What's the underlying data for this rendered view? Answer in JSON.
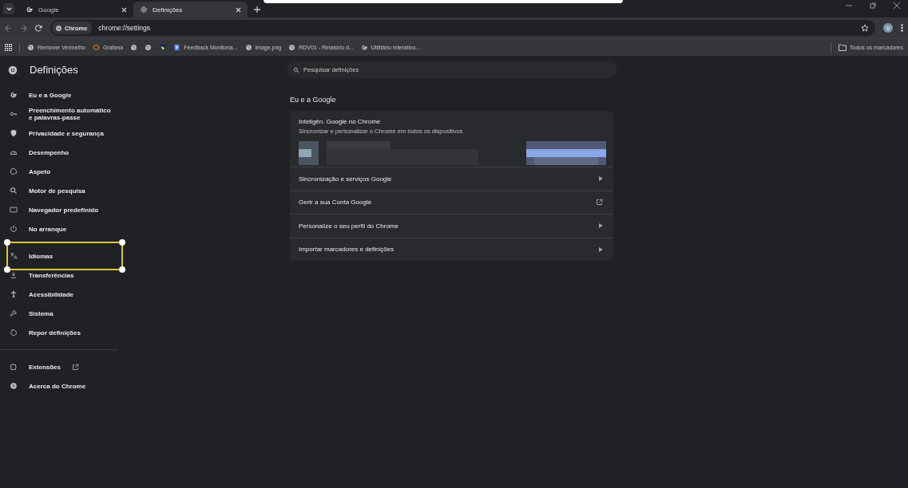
{
  "tabs": [
    {
      "title": "Google",
      "kind": "google",
      "selected": false
    },
    {
      "title": "Definições",
      "kind": "gear",
      "selected": true
    }
  ],
  "toolbar": {
    "chip": "Chrome",
    "url": "chrome://settings",
    "profile": "V"
  },
  "bookmarks": [
    {
      "kind": "globe",
      "title": "Remover Vermelho"
    },
    {
      "kind": "grafana",
      "title": "Grafana"
    },
    {
      "kind": "globe"
    },
    {
      "kind": "globe"
    },
    {
      "kind": "hand"
    },
    {
      "kind": "doc",
      "title": "Feedback Monitoria..."
    },
    {
      "kind": "globe",
      "title": "image.png"
    },
    {
      "kind": "globe",
      "title": "RDV01 - Relatório d..."
    },
    {
      "kind": "google",
      "title": "Utilitário interativo..."
    }
  ],
  "all_bookmarks": "Todos os marcadores",
  "sidebar": {
    "title": "Definições",
    "items": [
      {
        "kind": "google",
        "label": "Eu e a Google",
        "annotated": false
      },
      {
        "kind": "key",
        "label": "Preenchimento automático e palavras-passe",
        "annotated": false
      },
      {
        "kind": "shield",
        "label": "Privacidade e segurança",
        "annotated": false
      },
      {
        "kind": "gauge",
        "label": "Desempenho",
        "annotated": false
      },
      {
        "kind": "palette",
        "label": "Aspeto",
        "annotated": false
      },
      {
        "kind": "search",
        "label": "Motor de pesquisa",
        "annotated": false
      },
      {
        "kind": "window",
        "label": "Navegador predefinido",
        "annotated": false
      },
      {
        "kind": "power",
        "label": "No arranque",
        "annotated": false
      },
      {
        "kind": "translate",
        "label": "Idiomas",
        "annotated": true
      },
      {
        "kind": "download",
        "label": "Transferências",
        "annotated": false
      },
      {
        "kind": "person",
        "label": "Acessibilidade",
        "annotated": false
      },
      {
        "kind": "wrench",
        "label": "Sistema",
        "annotated": false
      },
      {
        "kind": "reset",
        "label": "Repor definições",
        "annotated": false
      }
    ],
    "extra": [
      {
        "kind": "puzzle",
        "label": "Extensões",
        "external": true
      },
      {
        "kind": "chrome",
        "label": "Acerca do Chrome",
        "external": false
      }
    ]
  },
  "search": {
    "placeholder": "Pesquisar definições"
  },
  "section": {
    "title": "Eu e a Google",
    "card": {
      "title": "Inteligên. Google no Chrome",
      "subtitle": "Sincronizar e personalizar o Chrome em todos os dispositivos",
      "rows": [
        {
          "label": "Sincronização e serviços Google",
          "kind": "arrow"
        },
        {
          "label": "Gerir a sua Conta Google",
          "kind": "external"
        },
        {
          "label": "Personalize o seu perfil do Chrome",
          "kind": "arrow"
        },
        {
          "label": "Importar marcadores e definições",
          "kind": "arrow"
        }
      ]
    }
  }
}
